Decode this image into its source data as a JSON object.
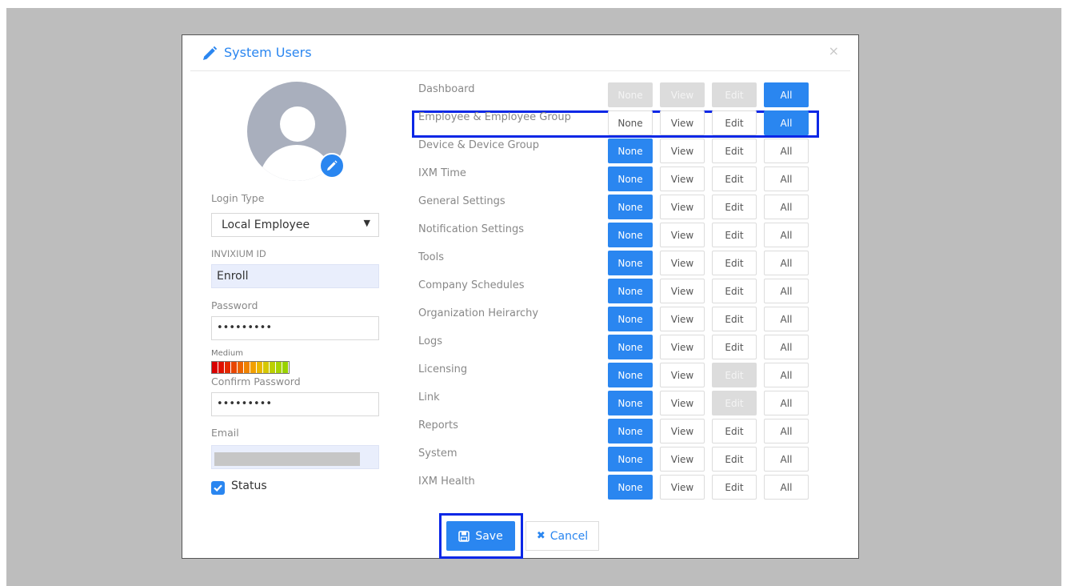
{
  "dialog": {
    "title": "System Users",
    "close_icon": "×"
  },
  "form": {
    "login_type_label": "Login Type",
    "login_type_value": "Local Employee",
    "invixium_id_label": "INVIXIUM ID",
    "invixium_id_value": "Enroll",
    "password_label": "Password",
    "password_value": "•••••••••",
    "strength_label": "Medium",
    "confirm_password_label": "Confirm Password",
    "confirm_password_value": "•••••••••",
    "email_label": "Email",
    "status_label": "Status",
    "status_checked": true
  },
  "permissions": {
    "levels": [
      "None",
      "View",
      "Edit",
      "All"
    ],
    "rows": [
      {
        "label": "Dashboard",
        "selected": "All",
        "disabled": [
          "None",
          "View",
          "Edit"
        ]
      },
      {
        "label": "Employee & Employee Group",
        "selected": "All",
        "disabled": []
      },
      {
        "label": "Device & Device Group",
        "selected": "None",
        "disabled": []
      },
      {
        "label": "IXM Time",
        "selected": "None",
        "disabled": []
      },
      {
        "label": "General Settings",
        "selected": "None",
        "disabled": []
      },
      {
        "label": "Notification Settings",
        "selected": "None",
        "disabled": []
      },
      {
        "label": "Tools",
        "selected": "None",
        "disabled": []
      },
      {
        "label": "Company Schedules",
        "selected": "None",
        "disabled": []
      },
      {
        "label": "Organization Heirarchy",
        "selected": "None",
        "disabled": []
      },
      {
        "label": "Logs",
        "selected": "None",
        "disabled": []
      },
      {
        "label": "Licensing",
        "selected": "None",
        "disabled": [
          "Edit"
        ]
      },
      {
        "label": "Link",
        "selected": "None",
        "disabled": [
          "Edit"
        ]
      },
      {
        "label": "Reports",
        "selected": "None",
        "disabled": []
      },
      {
        "label": "System",
        "selected": "None",
        "disabled": []
      },
      {
        "label": "IXM Health",
        "selected": "None",
        "disabled": []
      }
    ]
  },
  "actions": {
    "save_label": "Save",
    "cancel_label": "Cancel"
  },
  "colors": {
    "accent": "#2a86f0",
    "highlight": "#0a27e6",
    "disabled": "#dcdcdc"
  }
}
